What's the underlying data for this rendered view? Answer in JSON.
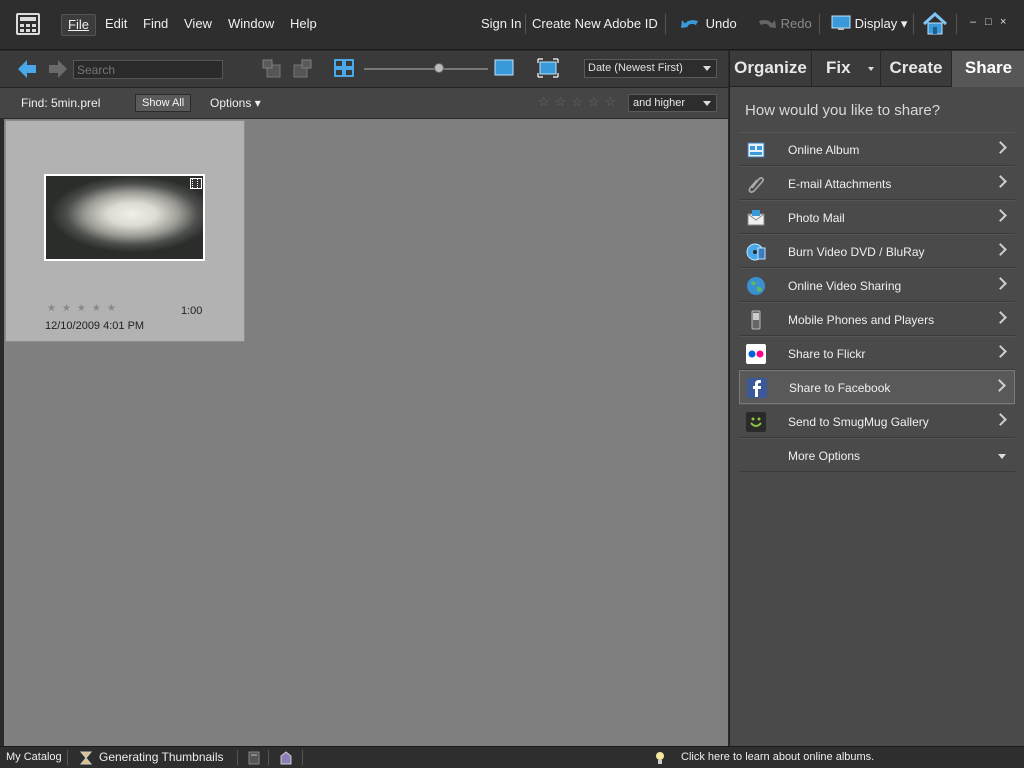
{
  "menubar": {
    "items": [
      {
        "label": "File"
      },
      {
        "label": "Edit"
      },
      {
        "label": "Find"
      },
      {
        "label": "View"
      },
      {
        "label": "Window"
      },
      {
        "label": "Help"
      }
    ],
    "sign_in": "Sign In",
    "create_id": "Create New Adobe ID",
    "undo": "Undo",
    "redo": "Redo",
    "display": "Display",
    "window_controls": [
      "–",
      "□",
      "×"
    ]
  },
  "toolbar": {
    "search_placeholder": "Search",
    "sort": "Date (Newest First)"
  },
  "findbar": {
    "find_label": "Find: 5min.prel",
    "show_all": "Show All",
    "options": "Options",
    "stars": "☆☆☆☆☆",
    "rating_filter": "and higher"
  },
  "thumbnail": {
    "stars": "★★★★★",
    "duration": "1:00",
    "date": "12/10/2009 4:01 PM"
  },
  "panel": {
    "tabs": [
      {
        "label": "Organize"
      },
      {
        "label": "Fix"
      },
      {
        "label": "Create"
      },
      {
        "label": "Share"
      }
    ],
    "question": "How would you like to share?",
    "items": [
      {
        "label": "Online Album",
        "icon": "online-album-icon"
      },
      {
        "label": "E-mail Attachments",
        "icon": "paperclip-icon"
      },
      {
        "label": "Photo Mail",
        "icon": "photo-mail-icon"
      },
      {
        "label": "Burn Video DVD / BluRay",
        "icon": "disc-icon"
      },
      {
        "label": "Online Video Sharing",
        "icon": "globe-icon"
      },
      {
        "label": "Mobile Phones and Players",
        "icon": "phone-icon"
      },
      {
        "label": "Share to Flickr",
        "icon": "flickr-icon"
      },
      {
        "label": "Share to Facebook",
        "icon": "facebook-icon"
      },
      {
        "label": "Send to SmugMug Gallery",
        "icon": "smugmug-icon"
      },
      {
        "label": "More Options",
        "icon": ""
      }
    ]
  },
  "statusbar": {
    "catalog": "My Catalog",
    "status": "Generating Thumbnails",
    "tip": "Click here to learn about online albums."
  },
  "colors": {
    "accent_blue": "#3a9ad9",
    "grid_bg": "#7f7f7f",
    "panel_bg": "#4a4a4a"
  }
}
